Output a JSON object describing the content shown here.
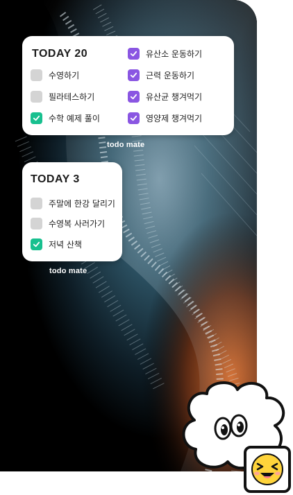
{
  "colors": {
    "unchecked": "#d4d4d4",
    "checked_green": "#18c08f",
    "checked_purple": "#8a56e2",
    "wallpaper_accent": "#1f4f63",
    "wallpaper_warm": "#c5602a"
  },
  "widget_large": {
    "title": "TODAY 20",
    "items": [
      {
        "label": "수영하기",
        "checked": false,
        "color": "gray"
      },
      {
        "label": "필라테스하기",
        "checked": false,
        "color": "gray"
      },
      {
        "label": "수학 예제 풀이",
        "checked": true,
        "color": "green"
      },
      {
        "label": "유산소 운동하기",
        "checked": true,
        "color": "purple"
      },
      {
        "label": "근력 운동하기",
        "checked": true,
        "color": "purple"
      },
      {
        "label": "유산균 챙겨먹기",
        "checked": true,
        "color": "purple"
      },
      {
        "label": "영양제 챙겨먹기",
        "checked": true,
        "color": "purple"
      }
    ],
    "brand": "todo mate"
  },
  "widget_small": {
    "title": "TODAY 3",
    "items": [
      {
        "label": "주말에 한강 달리기",
        "checked": false,
        "color": "gray"
      },
      {
        "label": "수영복 사러가기",
        "checked": false,
        "color": "gray"
      },
      {
        "label": "저녁 산책",
        "checked": true,
        "color": "green"
      }
    ],
    "brand": "todo mate"
  },
  "mascot": {
    "icon": "cloud-mascot-icon",
    "emoji_icon": "laughing-emoji-icon"
  }
}
